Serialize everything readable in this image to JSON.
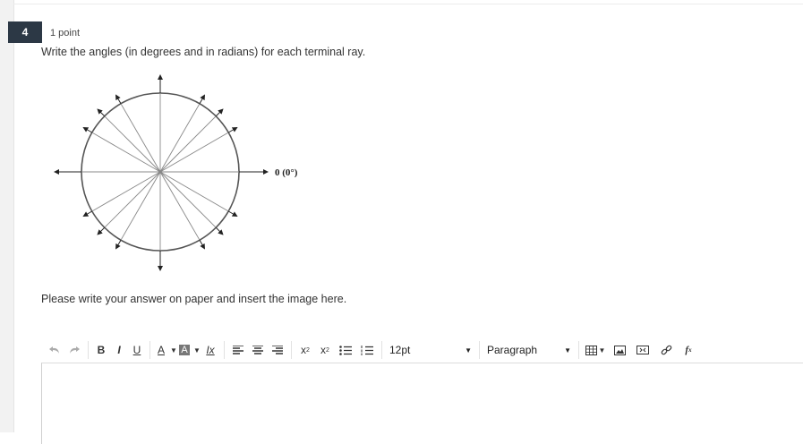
{
  "question": {
    "number": "4",
    "points": "1 point",
    "prompt": "Write the angles (in degrees and in radians) for each terminal ray.",
    "figure_label": "0 (0°)",
    "instruction": "Please write your answer on paper and insert the image here."
  },
  "toolbar": {
    "undo_icon": "undo-icon",
    "redo_icon": "redo-icon",
    "bold": "B",
    "italic": "I",
    "underline": "U",
    "text_color": "A",
    "highlight": "A",
    "clear_format": "Ix",
    "superscript": "x",
    "subscript": "x",
    "font_size": "12pt",
    "block_format": "Paragraph"
  },
  "editor": {
    "content": ""
  }
}
